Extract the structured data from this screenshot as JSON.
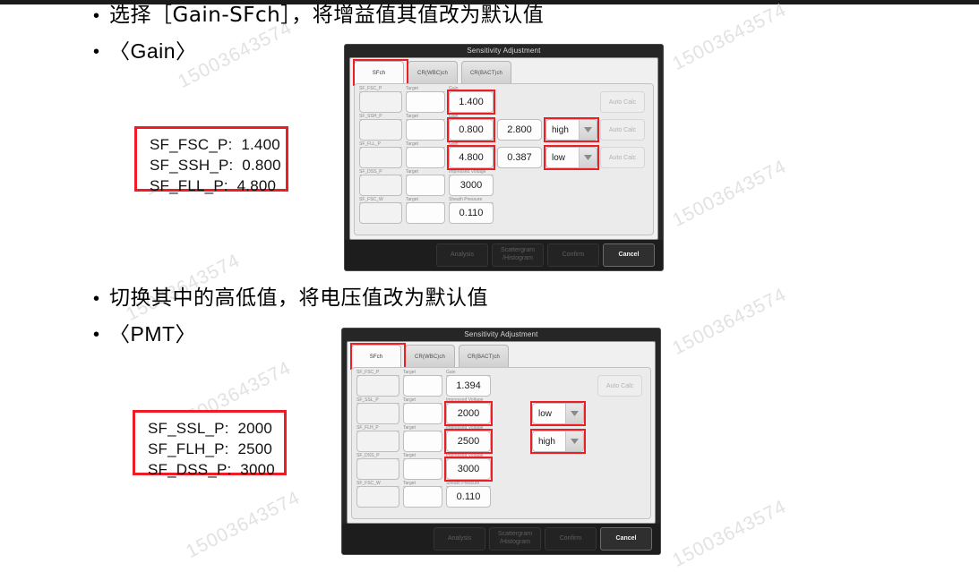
{
  "slide": {
    "bullets": [
      {
        "id": "b1",
        "text": "选择［Gain-SFch］，将增益值其值改为默认值"
      },
      {
        "id": "b2",
        "text": "〈Gain〉"
      },
      {
        "id": "b3",
        "text": "切换其中的高低值，将电压值改为默认值"
      },
      {
        "id": "b4",
        "text": "〈PMT〉"
      }
    ],
    "watermark_text": "15003643574"
  },
  "notes": {
    "gain_note": {
      "lines": [
        "SF_FSC_P:  1.400",
        "SF_SSH_P:  0.800",
        "SF_FLL_P:  4.800"
      ]
    },
    "pmt_note": {
      "lines": [
        "SF_SSL_P:  2000",
        "SF_FLH_P:  2500",
        "SF_DSS_P:  3000"
      ]
    }
  },
  "colors": {
    "highlight": "#ee1c25",
    "dialog_bg": "#262626",
    "panel_bg": "#ebebeb"
  },
  "dialog_gain": {
    "title": "Sensitivity Adjustment",
    "tabs": [
      {
        "label": "SFch",
        "active": true
      },
      {
        "label": "CR(WBC)ch",
        "active": false
      },
      {
        "label": "CR(BACT)ch",
        "active": false
      }
    ],
    "rows": [
      {
        "name": "SF_FSC_P",
        "target_caption": "Target",
        "value_caption": "Gain",
        "target": "",
        "value": "1.400",
        "extra": "",
        "mode": "",
        "auto_calc": "Auto Calc",
        "has_auto_calc": true,
        "value_highlighted": true,
        "mode_highlighted": false
      },
      {
        "name": "SF_SSH_P",
        "target_caption": "Target",
        "value_caption": "Gain",
        "target": "",
        "value": "0.800",
        "extra": "2.800",
        "mode": "high",
        "auto_calc": "Auto Calc",
        "has_auto_calc": true,
        "value_highlighted": true,
        "mode_highlighted": true
      },
      {
        "name": "SF_FLL_P",
        "target_caption": "Target",
        "value_caption": "Gain",
        "target": "",
        "value": "4.800",
        "extra": "0.387",
        "mode": "low",
        "auto_calc": "Auto Calc",
        "has_auto_calc": true,
        "value_highlighted": true,
        "mode_highlighted": true
      },
      {
        "name": "SF_DSS_P",
        "target_caption": "Target",
        "value_caption": "Impressed Voltage",
        "target": "",
        "value": "3000",
        "extra": "",
        "mode": "",
        "auto_calc": "",
        "has_auto_calc": false,
        "value_highlighted": false,
        "mode_highlighted": false
      },
      {
        "name": "SF_FSC_W",
        "target_caption": "Target",
        "value_caption": "Sheath Pressure",
        "target": "",
        "value": "0.110",
        "extra": "",
        "mode": "",
        "auto_calc": "",
        "has_auto_calc": false,
        "value_highlighted": false,
        "mode_highlighted": false
      }
    ],
    "footer_buttons": [
      {
        "label": "Analysis",
        "primary": false
      },
      {
        "label": "Scattergram\n/Histogram",
        "primary": false
      },
      {
        "label": "Confirm",
        "primary": false
      },
      {
        "label": "Cancel",
        "primary": true
      }
    ]
  },
  "dialog_pmt": {
    "title": "Sensitivity Adjustment",
    "tabs": [
      {
        "label": "SFch",
        "active": true
      },
      {
        "label": "CR(WBC)ch",
        "active": false
      },
      {
        "label": "CR(BACT)ch",
        "active": false
      }
    ],
    "rows": [
      {
        "name": "SF_FSC_P",
        "target_caption": "Target",
        "value_caption": "Gain",
        "target": "",
        "value": "1.394",
        "extra": "",
        "mode": "",
        "auto_calc": "Auto Calc",
        "has_auto_calc": true,
        "value_highlighted": false,
        "mode_highlighted": false
      },
      {
        "name": "SF_SSL_P",
        "target_caption": "Target",
        "value_caption": "Impressed Voltage",
        "target": "",
        "value": "2000",
        "extra": "",
        "mode": "low",
        "auto_calc": "",
        "has_auto_calc": false,
        "value_highlighted": true,
        "mode_highlighted": true
      },
      {
        "name": "SF_FLH_P",
        "target_caption": "Target",
        "value_caption": "Impressed Voltage",
        "target": "",
        "value": "2500",
        "extra": "",
        "mode": "high",
        "auto_calc": "",
        "has_auto_calc": false,
        "value_highlighted": true,
        "mode_highlighted": true
      },
      {
        "name": "SF_DSS_P",
        "target_caption": "Target",
        "value_caption": "Impressed Voltage",
        "target": "",
        "value": "3000",
        "extra": "",
        "mode": "",
        "auto_calc": "",
        "has_auto_calc": false,
        "value_highlighted": true,
        "mode_highlighted": false
      },
      {
        "name": "SF_FSC_W",
        "target_caption": "Target",
        "value_caption": "Sheath Pressure",
        "target": "",
        "value": "0.110",
        "extra": "",
        "mode": "",
        "auto_calc": "",
        "has_auto_calc": false,
        "value_highlighted": false,
        "mode_highlighted": false
      }
    ],
    "footer_buttons": [
      {
        "label": "Analysis",
        "primary": false
      },
      {
        "label": "Scattergram\n/Histogram",
        "primary": false
      },
      {
        "label": "Confirm",
        "primary": false
      },
      {
        "label": "Cancel",
        "primary": true
      }
    ]
  }
}
